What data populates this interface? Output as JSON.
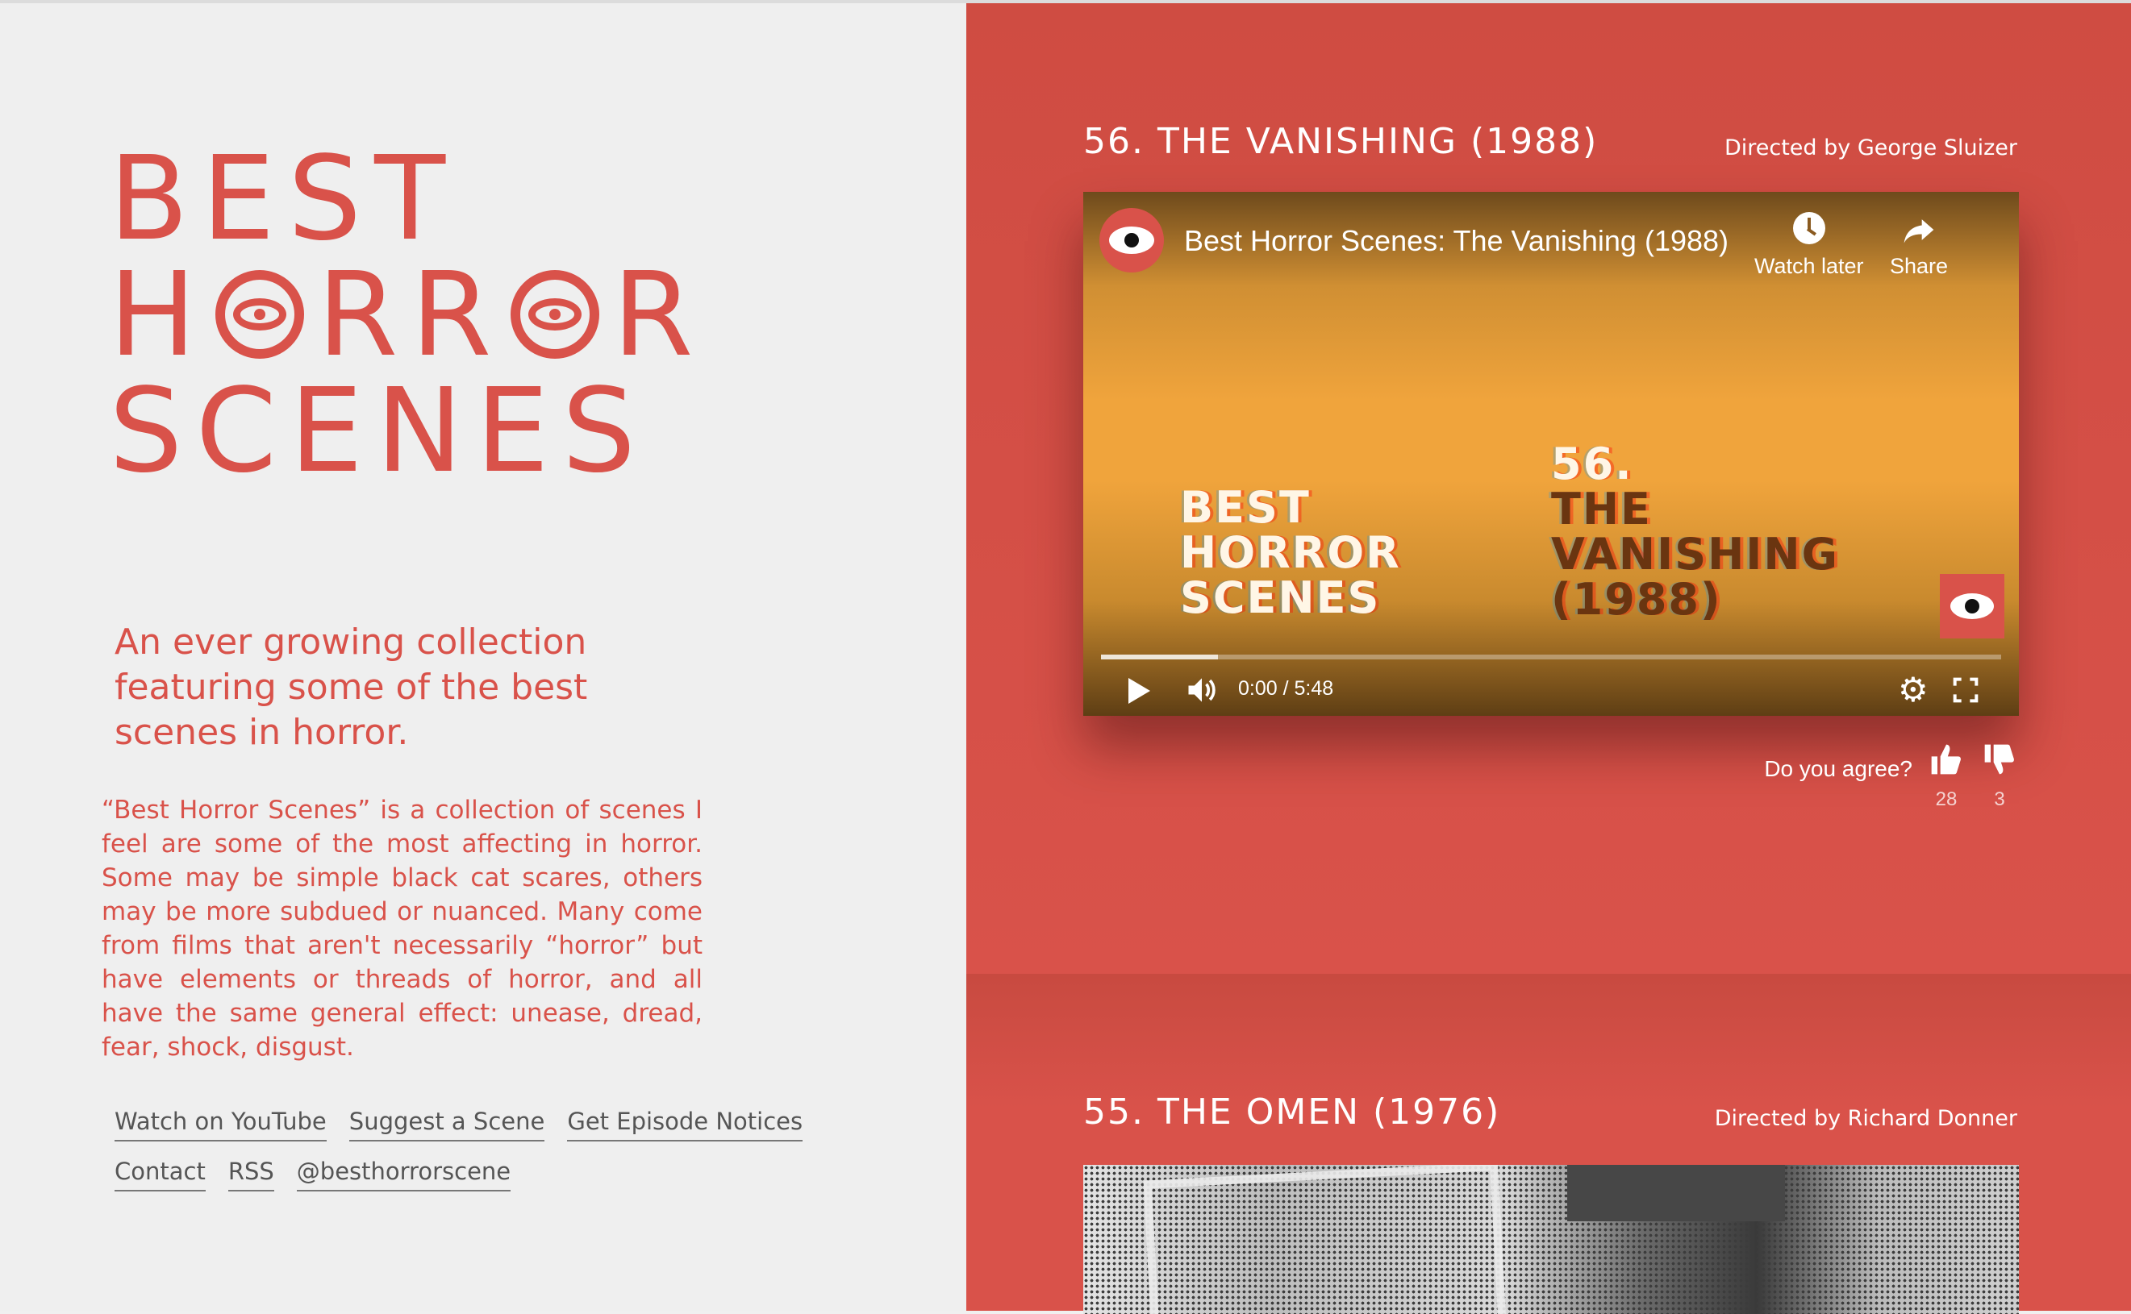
{
  "site": {
    "logo_lines": [
      "BEST",
      "HORROR",
      "SCENES"
    ],
    "logo_parts": {
      "l2_a": "H",
      "l2_b": "RR",
      "l2_c": "R"
    },
    "tagline": "An ever growing collection featuring some of the best scenes in horror.",
    "about": "“Best Horror Scenes” is a collection of scenes I feel are some of the most affecting in horror. Some may be simple black cat scares, others may be more subdued or nuanced. Many come from films that aren't necessarily “horror” but have elements or threads of horror, and all have the same general effect: unease, dread, fear, shock, disgust.",
    "links_row1": [
      "Watch on YouTube",
      "Suggest a Scene",
      "Get Episode Notices"
    ],
    "links_row2": [
      "Contact",
      "RSS",
      "@besthorrorscene"
    ]
  },
  "scenes": [
    {
      "title": "56. THE VANISHING (1988)",
      "director": "Directed by George Sluizer",
      "player": {
        "video_title": "Best Horror Scenes: The Vanishing (1988)",
        "watch_later": "Watch later",
        "share": "Share",
        "overlay_left": [
          "BEST",
          "HORROR",
          "SCENES"
        ],
        "overlay_number": "56.",
        "overlay_name": [
          "THE",
          "VANISHING",
          "(1988)"
        ],
        "time": "0:00 / 5:48",
        "buffered_fraction": 0.13
      },
      "agree_label": "Do you agree?",
      "thumbs_up": "28",
      "thumbs_down": "3"
    },
    {
      "title": "55. THE OMEN (1976)",
      "director": "Directed by Richard Donner"
    }
  ],
  "colors": {
    "accent": "#d9524a",
    "right_bg": "#d84c42",
    "left_bg": "#efefef"
  },
  "icons": [
    "eye-icon",
    "clock-icon",
    "share-arrow-icon",
    "play-icon",
    "volume-icon",
    "gear-icon",
    "fullscreen-icon",
    "thumbs-up-icon",
    "thumbs-down-icon"
  ]
}
